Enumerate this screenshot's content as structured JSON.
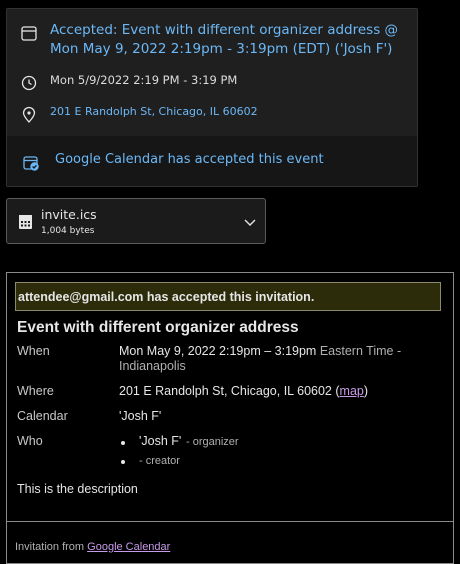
{
  "event_card": {
    "title": "Accepted: Event with different organizer address @ Mon May 9, 2022 2:19pm - 3:19pm (EDT) ('Josh F')",
    "time": "Mon 5/9/2022 2:19 PM - 3:19 PM",
    "location": "201 E Randolph St, Chicago, IL 60602",
    "status": "Google Calendar has accepted this event",
    "accent_color": "#6cb8f6"
  },
  "attachment": {
    "file_name": "invite.ics",
    "file_size": "1,004 bytes",
    "icon": "calendar-file-icon"
  },
  "invitation": {
    "banner": "attendee@gmail.com has accepted this invitation.",
    "title": "Event with different organizer address",
    "when_label": "When",
    "when_time": "Mon May 9, 2022 2:19pm – 3:19pm",
    "when_zone": "Eastern Time - Indianapolis",
    "where_label": "Where",
    "where_value": "201 E Randolph St, Chicago, IL 60602",
    "where_open": "(",
    "map_label": "map",
    "where_close": ")",
    "calendar_label": "Calendar",
    "calendar_value": "'Josh F'",
    "who_label": "Who",
    "who": [
      {
        "name": "'Josh F'",
        "role": "- organizer"
      },
      {
        "name": "",
        "role": "- creator"
      }
    ],
    "description": "This is the description",
    "footer_prefix": "Invitation from",
    "footer_link": "Google Calendar"
  }
}
